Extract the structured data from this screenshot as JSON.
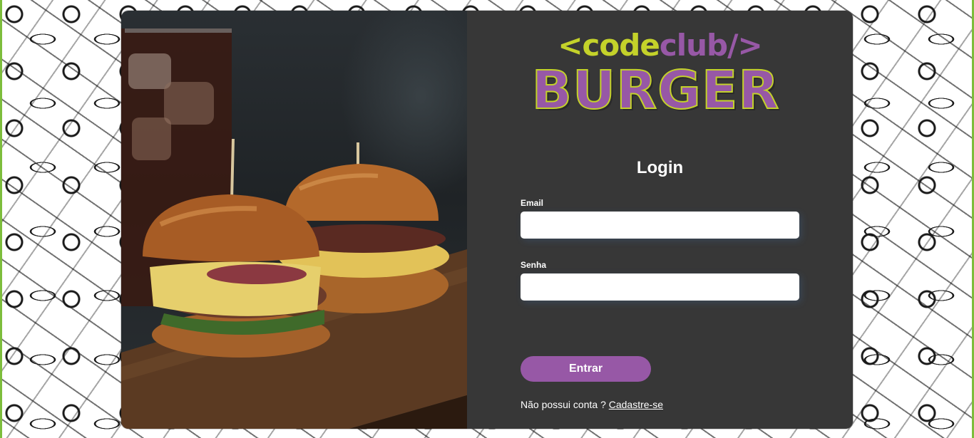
{
  "logo": {
    "line1_prefix": "<code",
    "line1_suffix": "club/>",
    "line2": "BURGER"
  },
  "login": {
    "title": "Login",
    "email_label": "Email",
    "email_value": "",
    "password_label": "Senha",
    "password_value": "",
    "submit_label": "Entrar",
    "signup_prompt": "Não possui conta ?",
    "signup_link": "Cadastre-se"
  },
  "colors": {
    "brand_purple": "#9758a6",
    "brand_lime": "#c4d22a",
    "panel_bg": "#373737",
    "frame_green": "#7dbd3c"
  }
}
